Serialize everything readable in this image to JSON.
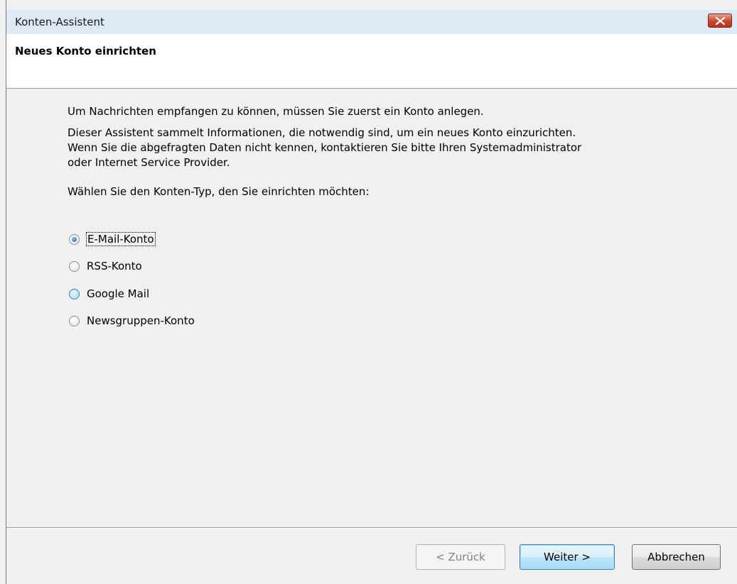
{
  "window": {
    "title": "Konten-Assistent",
    "close_icon": "close-icon",
    "colors": {
      "titlebar": "#dfe9f5",
      "close": "#c9462c",
      "accent": "#3c7fb1"
    }
  },
  "header": {
    "title": "Neues Konto einrichten"
  },
  "content": {
    "intro": "Um Nachrichten empfangen zu können, müssen Sie zuerst ein Konto anlegen.",
    "description": "Dieser Assistent sammelt Informationen, die notwendig sind, um ein neues Konto einzurichten.\nWenn Sie die abgefragten Daten nicht kennen, kontaktieren Sie bitte Ihren Systemadministrator\noder Internet Service Provider.",
    "prompt": "Wählen Sie den Konten-Typ, den Sie einrichten möchten:",
    "options": [
      {
        "label": "E-Mail-Konto",
        "checked": true
      },
      {
        "label": "RSS-Konto",
        "checked": false
      },
      {
        "label": "Google Mail",
        "checked": false
      },
      {
        "label": "Newsgruppen-Konto",
        "checked": false
      }
    ]
  },
  "footer": {
    "back_label": "< Zurück",
    "next_label": "Weiter >",
    "cancel_label": "Abbrechen"
  }
}
